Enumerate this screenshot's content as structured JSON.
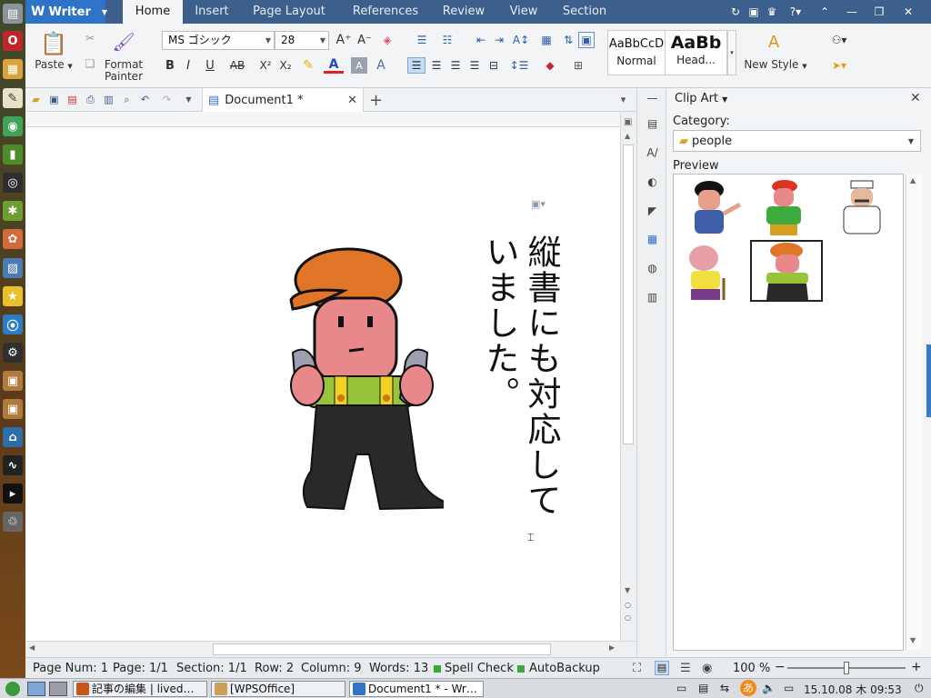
{
  "app": {
    "name": "Writer"
  },
  "menu": {
    "tabs": [
      "Home",
      "Insert",
      "Page Layout",
      "References",
      "Review",
      "View",
      "Section"
    ],
    "active": "Home"
  },
  "ribbon": {
    "paste_label": "Paste",
    "format_painter_label": "Format\nPainter",
    "font_name": "MS ゴシック",
    "font_size": "28",
    "styles": [
      {
        "preview": "AaBbCcD",
        "name": "Normal"
      },
      {
        "preview": "AaBb",
        "name": "Head..."
      }
    ],
    "new_style_label": "New Style",
    "format_buttons": {
      "bold": "B",
      "italic": "I",
      "underline": "U",
      "strike": "AB",
      "superscript": "X²",
      "subscript": "X₂"
    }
  },
  "document": {
    "tab_title": "Document1 *",
    "text_col1": "縦書にも対応して",
    "text_col2": "いました。"
  },
  "clipart": {
    "title": "Clip Art",
    "category_label": "Category:",
    "category_value": "people",
    "preview_label": "Preview",
    "thumbs": [
      "businessman",
      "worker-with-tool",
      "doctor",
      "old-man",
      "mechanic"
    ],
    "selected_index": 4
  },
  "status": {
    "page_num": "Page Num: 1",
    "page": "Page: 1/1",
    "section": "Section: 1/1",
    "row": "Row: 2",
    "column": "Column: 9",
    "words": "Words: 13",
    "spell_check": "Spell Check",
    "autobackup": "AutoBackup",
    "zoom": "100 %",
    "zoom_level": 0.5
  },
  "taskbar": {
    "items": [
      {
        "label": "記事の編集 | lived…",
        "icon_color": "#c8551a"
      },
      {
        "label": "[WPSOffice]",
        "icon_color": "#c9a15a"
      },
      {
        "label": "Document1 * - Wr…",
        "icon_color": "#2f73c6"
      }
    ],
    "ime": "あ",
    "clock": "15.10.08 木 09:53"
  },
  "colors": {
    "menubar": "#3c5f8c",
    "app_button": "#2f73c6",
    "ribbon": "#f3f4f6"
  }
}
